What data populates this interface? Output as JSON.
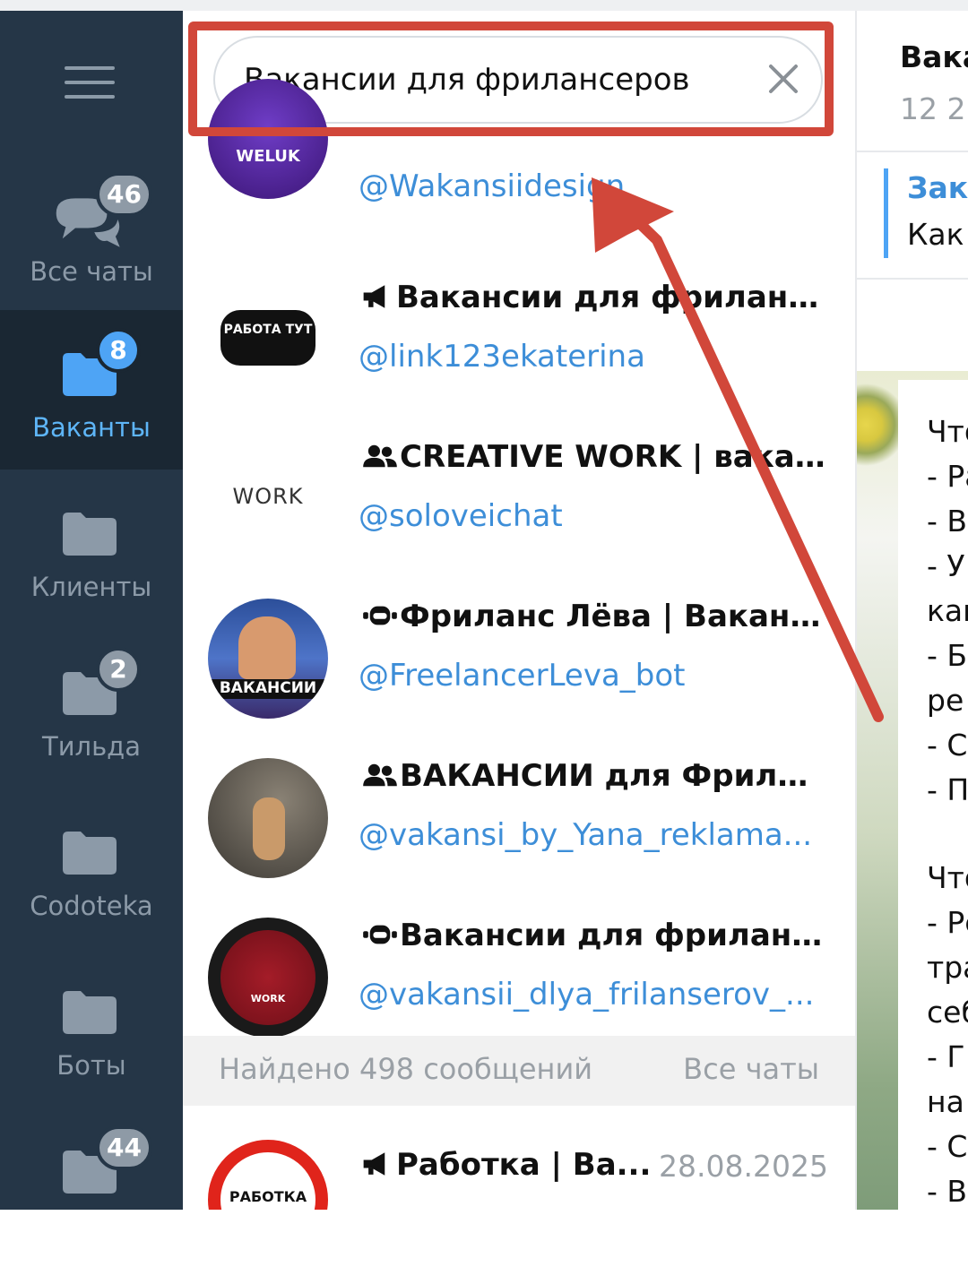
{
  "sidebar": {
    "folders": [
      {
        "label": "Все чаты",
        "badge": "46"
      },
      {
        "label": "Ваканты",
        "badge": "8"
      },
      {
        "label": "Клиенты",
        "badge": ""
      },
      {
        "label": "Тильда",
        "badge": "2"
      },
      {
        "label": "Codoteka",
        "badge": ""
      },
      {
        "label": "Боты",
        "badge": ""
      },
      {
        "label": "",
        "badge": "44"
      }
    ]
  },
  "search": {
    "query": "Вакансии для фрилансеров"
  },
  "results": [
    {
      "title": "",
      "username": "@Wakansiidesign",
      "kind": "",
      "avatar_text": "WELUK"
    },
    {
      "title": "Вакансии для фриланс...",
      "username": "@link123ekaterina",
      "kind": "megaphone-icon",
      "avatar_text": "РАБОТА ТУТ"
    },
    {
      "title": "CREATIVE WORK | вака...",
      "username": "@soloveichat",
      "kind": "group-icon",
      "avatar_text": "WORK"
    },
    {
      "title": "Фриланс Лёва | Ваканс...",
      "username": "@FreelancerLeva_bot",
      "kind": "bot-icon",
      "avatar_text": "ВАКАНСИИ"
    },
    {
      "title": "ВАКАНСИИ для Фрила...",
      "username": "@vakansi_by_Yana_reklama...",
      "kind": "group-icon",
      "avatar_text": ""
    },
    {
      "title": "Вакансии для фриланс...",
      "username": "@vakansii_dlya_frilanserov_...",
      "kind": "bot-icon",
      "avatar_text": "WORK"
    }
  ],
  "found": {
    "text": "Найдено 498 сообщений",
    "scope": "Все чаты"
  },
  "message_result": {
    "title": "Работка | Ва...",
    "date": "28.08.2025",
    "avatar_text": "РАБОТКА"
  },
  "chat": {
    "title": "Вака",
    "subtitle": "12 2",
    "pinned_title": "Зак",
    "pinned_text": "Как",
    "lines": [
      "Что",
      "- Ра",
      "- В",
      "- У",
      "как",
      "- Б",
      "ре",
      "- С",
      "- П",
      "",
      "Что",
      "- Ре",
      "тра",
      "себ",
      "- Г",
      "на",
      "- С",
      "- В"
    ]
  },
  "colors": {
    "sidebar": "#253647",
    "sidebar_active": "#1a2733",
    "accent": "#4ea4f5",
    "link": "#3d8ed8",
    "annotation": "#d1473a"
  }
}
